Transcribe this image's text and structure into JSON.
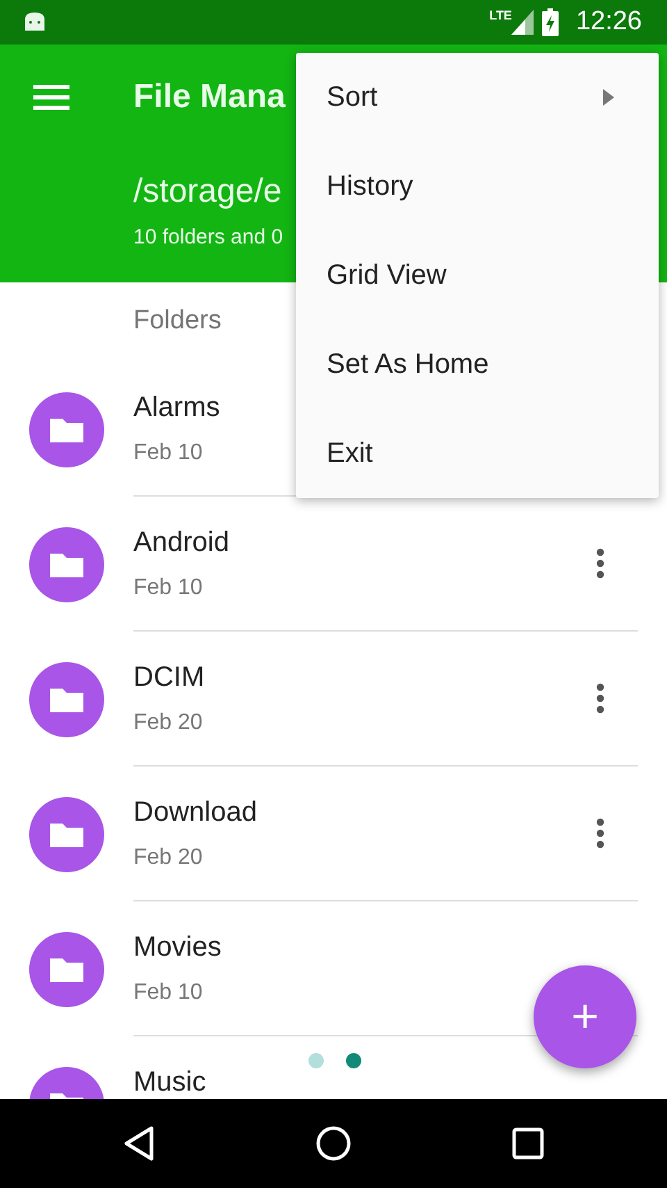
{
  "status_bar": {
    "network": "LTE",
    "time": "12:26"
  },
  "toolbar": {
    "title": "File Mana",
    "path": "/storage/e",
    "summary": "10 folders and 0"
  },
  "section_header": "Folders",
  "folders": [
    {
      "name": "Alarms",
      "date": "Feb 10",
      "more_button": false
    },
    {
      "name": "Android",
      "date": "Feb 10",
      "more_button": true
    },
    {
      "name": "DCIM",
      "date": "Feb 20",
      "more_button": true
    },
    {
      "name": "Download",
      "date": "Feb 20",
      "more_button": true
    },
    {
      "name": "Movies",
      "date": "Feb 10",
      "more_button": false
    },
    {
      "name": "Music"
    }
  ],
  "menu": [
    {
      "label": "Sort",
      "submenu": true
    },
    {
      "label": "History",
      "submenu": false
    },
    {
      "label": "Grid View",
      "submenu": false
    },
    {
      "label": "Set As Home",
      "submenu": false
    },
    {
      "label": "Exit",
      "submenu": false
    }
  ],
  "page_dots": [
    {
      "selected": false
    },
    {
      "selected": true
    }
  ],
  "fab": {
    "label": "+"
  }
}
